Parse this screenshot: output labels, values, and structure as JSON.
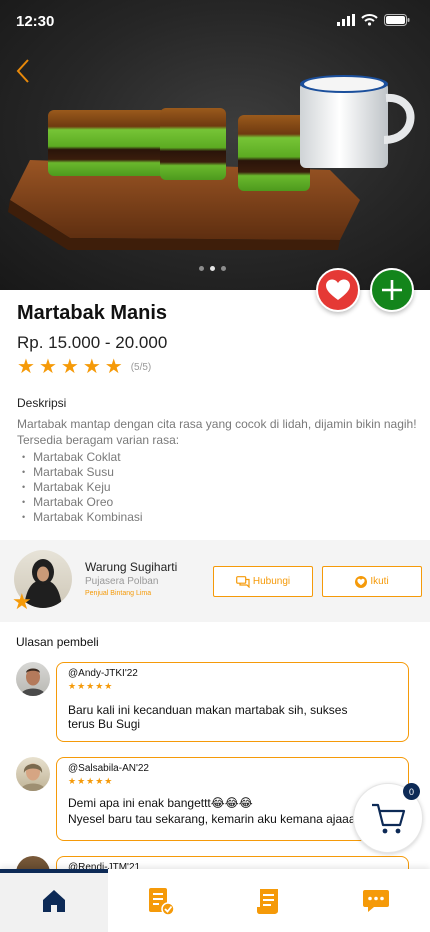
{
  "status": {
    "time": "12:30"
  },
  "hero": {
    "image": "martabak-photo",
    "pages": 3,
    "active_page": 2
  },
  "product": {
    "name": "Martabak Manis",
    "price": "Rp. 15.000 - 20.000",
    "rating": 5,
    "rating_text": "(5/5)",
    "description_title": "Deskripsi",
    "description_lines": [
      "Martabak mantap dengan cita rasa yang cocok di lidah, dijamin bikin nagih!",
      "Tersedia beragam varian rasa:"
    ],
    "variants": [
      "Martabak Coklat",
      "Martabak Susu",
      "Martabak Keju",
      "Martabak Oreo",
      "Martabak Kombinasi"
    ]
  },
  "shop": {
    "name": "Warung Sugiharti",
    "location": "Pujasera Polban",
    "tier": "Penjual Bintang Lima",
    "contact_label": "Hubungi",
    "follow_label": "Ikuti"
  },
  "reviews": {
    "title": "Ulasan pembeli",
    "items": [
      {
        "user": "@Andy-JTKI'22",
        "stars": "★★★★★",
        "lines": [
          "Baru kali ini kecanduan makan martabak sih, sukses",
          "terus Bu Sugi"
        ]
      },
      {
        "user": "@Salsabila-AN'22",
        "stars": "★★★★★",
        "lines": [
          "Demi apa ini enak bangettt😂😂😂",
          "Nyesel baru tau sekarang, kemarin aku kemana ajaaaa"
        ]
      },
      {
        "user": "@Rendi-JTM'21",
        "stars": "",
        "lines": []
      }
    ]
  },
  "cart": {
    "count": "0"
  },
  "colors": {
    "accent": "#f59a09",
    "navy": "#0d2a56",
    "favorite": "#e53935",
    "add": "#13851b"
  },
  "nav": {
    "items": [
      "home-icon",
      "orders-icon",
      "receipt-icon",
      "chat-icon"
    ],
    "active": "home-icon"
  }
}
